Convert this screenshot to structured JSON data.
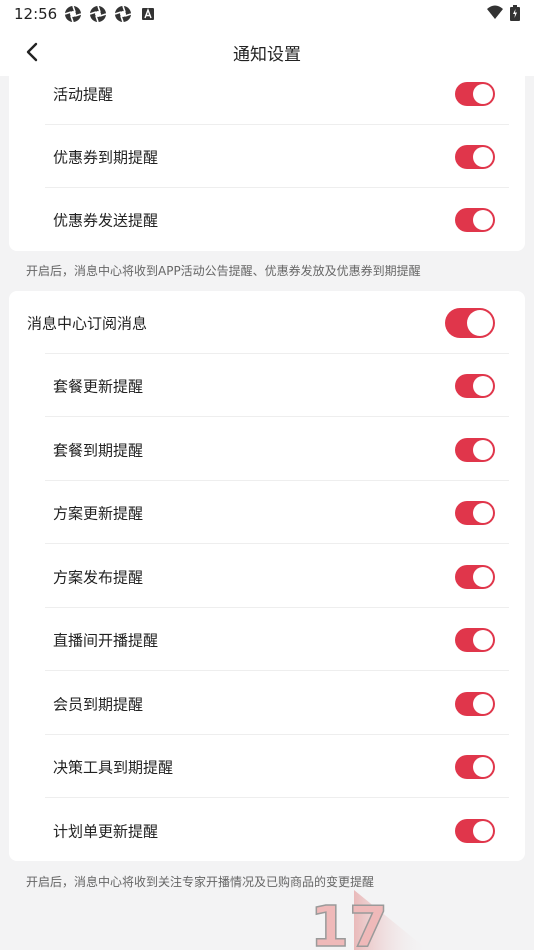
{
  "status_bar": {
    "time": "12:56",
    "icons": [
      "aperture-icon",
      "aperture-icon",
      "aperture-icon",
      "a-square-icon"
    ],
    "right_icons": [
      "wifi-icon",
      "battery-icon"
    ]
  },
  "header": {
    "title": "通知设置",
    "back_icon": "back-chevron-icon"
  },
  "section1": {
    "items": [
      {
        "label": "活动提醒",
        "enabled": true
      },
      {
        "label": "优惠券到期提醒",
        "enabled": true
      },
      {
        "label": "优惠券发送提醒",
        "enabled": true
      }
    ],
    "note": "开启后，消息中心将收到APP活动公告提醒、优惠券发放及优惠券到期提醒"
  },
  "section2": {
    "parent": {
      "label": "消息中心订阅消息",
      "enabled": true
    },
    "items": [
      {
        "label": "套餐更新提醒",
        "enabled": true
      },
      {
        "label": "套餐到期提醒",
        "enabled": true
      },
      {
        "label": "方案更新提醒",
        "enabled": true
      },
      {
        "label": "方案发布提醒",
        "enabled": true
      },
      {
        "label": "直播间开播提醒",
        "enabled": true
      },
      {
        "label": "会员到期提醒",
        "enabled": true
      },
      {
        "label": "决策工具到期提醒",
        "enabled": true
      },
      {
        "label": "计划单更新提醒",
        "enabled": true
      }
    ],
    "note": "开启后，消息中心将收到关注专家开播情况及已购商品的变更提醒"
  },
  "watermark": {
    "text": "17"
  },
  "colors": {
    "accent": "#e0364b",
    "background": "#f3f3f4",
    "card": "#ffffff"
  }
}
